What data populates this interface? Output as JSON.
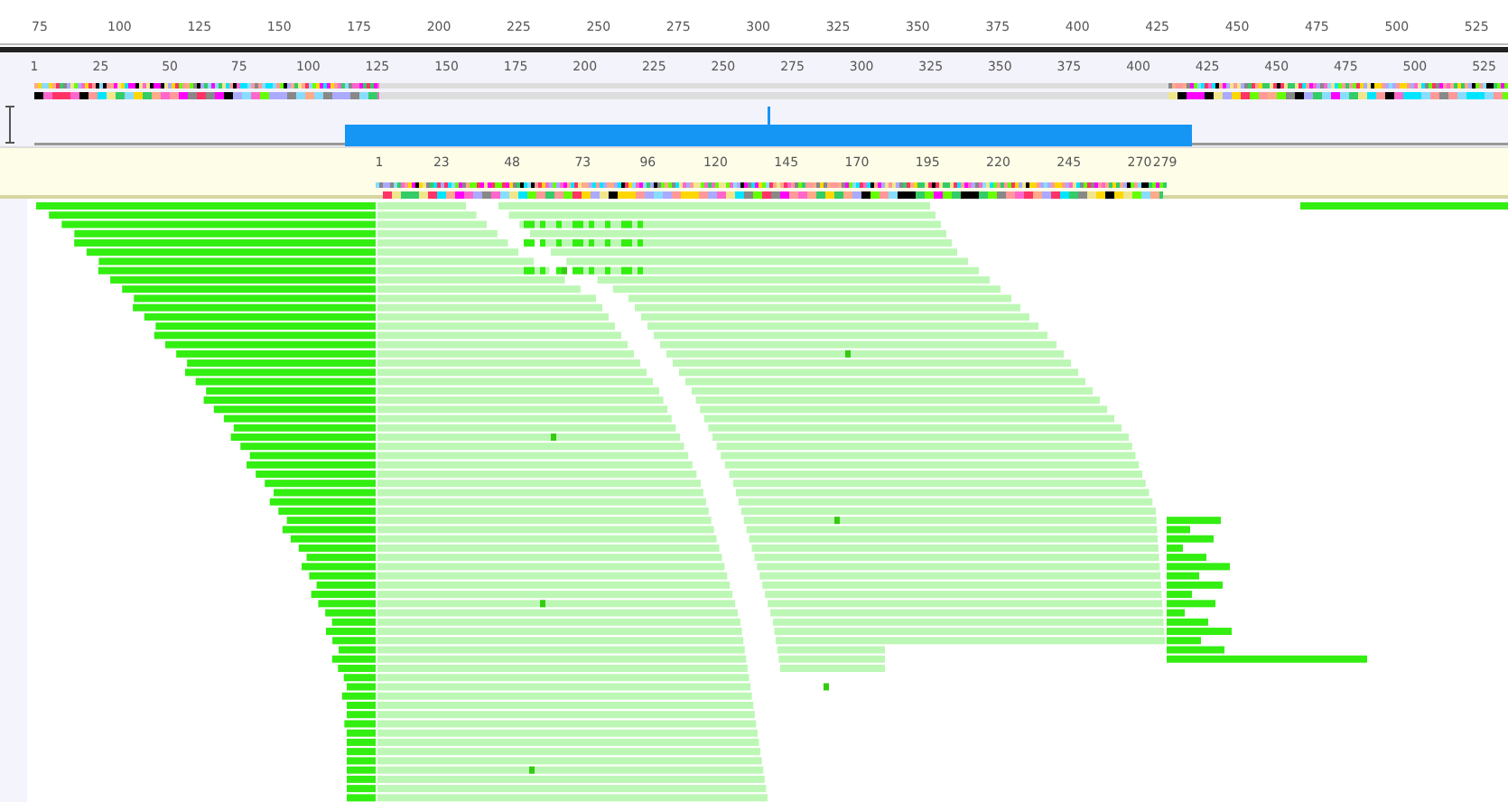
{
  "ruler_top": {
    "ticks": [
      "75",
      "100",
      "125",
      "150",
      "175",
      "200",
      "225",
      "250",
      "275",
      "300",
      "325",
      "350",
      "375",
      "400",
      "425",
      "450",
      "475",
      "500",
      "525"
    ]
  },
  "ruler_overview": {
    "ticks": [
      "1",
      "25",
      "50",
      "75",
      "100",
      "125",
      "150",
      "175",
      "200",
      "225",
      "250",
      "275",
      "300",
      "325",
      "350",
      "375",
      "400",
      "425",
      "450",
      "475",
      "500",
      "525"
    ]
  },
  "ruler_consensus": {
    "ticks": [
      "1",
      "23",
      "48",
      "73",
      "96",
      "120",
      "145",
      "170",
      "195",
      "220",
      "245",
      "270",
      "279"
    ]
  }
}
